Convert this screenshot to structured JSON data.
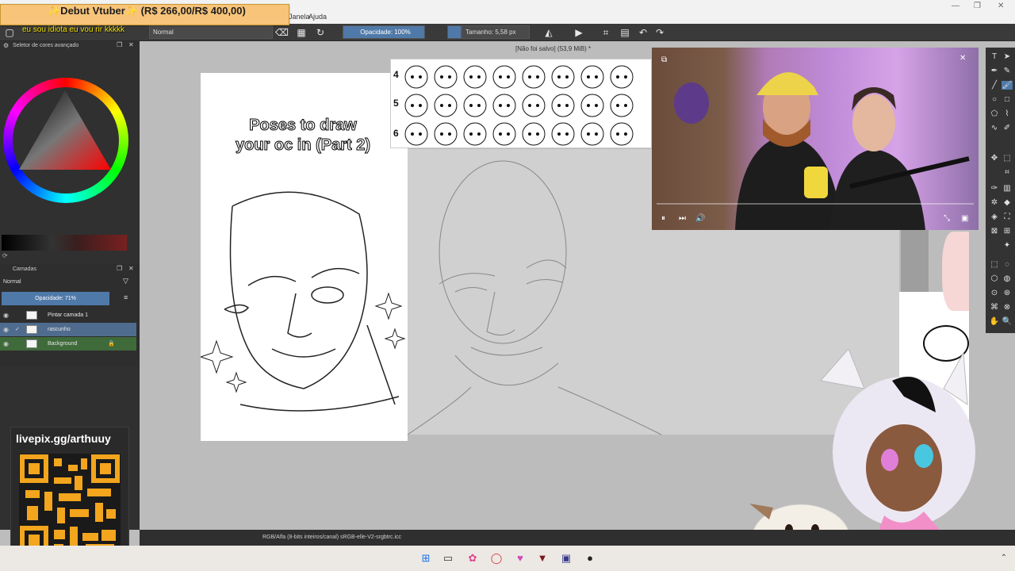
{
  "banner": {
    "title": "✨Debut Vtuber✨ (R$ 266,00/R$ 400,00)"
  },
  "chat": {
    "message": "eu sou idiota eu vou rir kkkkk"
  },
  "menu": {
    "items": [
      "Janela",
      "Ajuda"
    ]
  },
  "window": {
    "title": "[Não foi salvo]  (53,9 MiB) *"
  },
  "toolbar": {
    "blend_mode": "Normal",
    "opacity": "Opacidade: 100%",
    "size": "Tamanho: 5,58 px"
  },
  "color_selector": {
    "title": "Seletor de cores avançado"
  },
  "layers_panel": {
    "title": "Camadas",
    "blend_mode": "Normal",
    "opacity": "Opacidade:  71%",
    "layers": [
      {
        "name": "Pintar camada 1",
        "selected": false
      },
      {
        "name": "rascunho",
        "selected": true
      },
      {
        "name": "Background",
        "selected": false
      }
    ]
  },
  "canvas": {
    "title_text": "Poses to draw your oc in (Part 2)",
    "emote_rows": [
      "4",
      "5",
      "6"
    ]
  },
  "status": {
    "text": "RGB/Alfa (8-bits inteiros/canal)  sRGB-elle-V2-srgbtrc.icc"
  },
  "livepix": {
    "text": "livepix.gg/arthuuy"
  },
  "colors": {
    "banner": "#f7c47a",
    "accent": "#4f79a8",
    "selected_layer": "#4f6c8f"
  }
}
